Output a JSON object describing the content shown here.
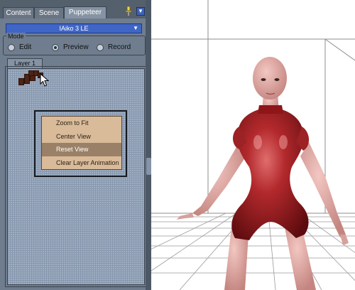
{
  "tabs": [
    {
      "label": "Content",
      "active": false
    },
    {
      "label": "Scene",
      "active": false
    },
    {
      "label": "Puppeteer",
      "active": true
    }
  ],
  "pin_icon": "pin-icon",
  "menu_icon": "panel-menu-icon",
  "figure_select": {
    "value": "IAiko 3 LE"
  },
  "mode": {
    "label": "Mode",
    "options": [
      {
        "label": "Edit",
        "selected": false
      },
      {
        "label": "Preview",
        "selected": true
      },
      {
        "label": "Record",
        "selected": false
      }
    ]
  },
  "layer_tab": {
    "label": "Layer 1"
  },
  "context_menu": {
    "items": [
      {
        "label": "Zoom to Fit",
        "highlighted": false
      },
      {
        "label": "Center View",
        "highlighted": false
      },
      {
        "label": "Reset View",
        "highlighted": true
      },
      {
        "label": "Clear Layer Animation",
        "highlighted": false
      }
    ]
  },
  "colors": {
    "panel_bg": "#6f7d8e",
    "dropdown_blue": "#3f65c6",
    "menu_bg": "#d9bb9a",
    "menu_highlight": "#9a8066",
    "figure_suit": "#8e1518",
    "figure_skin": "#e2a6a0"
  }
}
